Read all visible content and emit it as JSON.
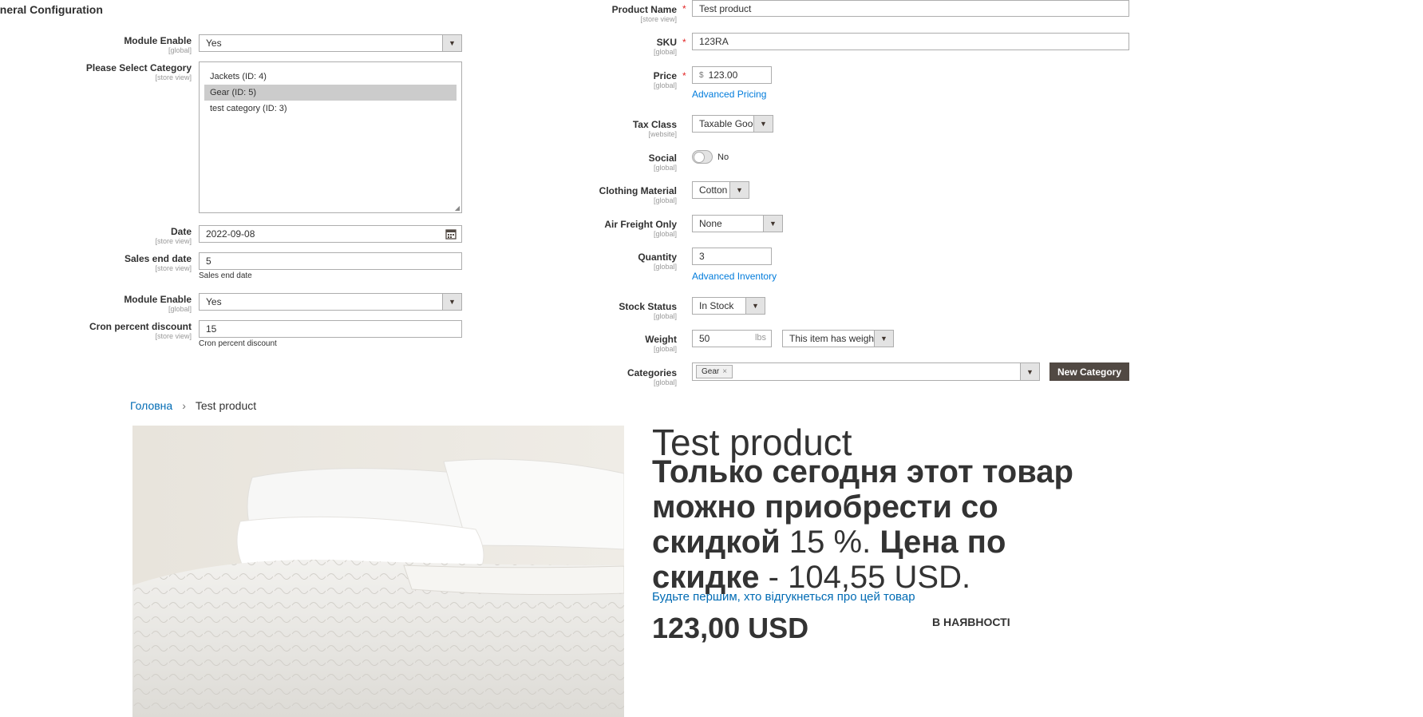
{
  "config": {
    "section_title": "eneral Configuration",
    "module_enable_1": {
      "label": "Module Enable",
      "scope": "[global]",
      "value": "Yes"
    },
    "category": {
      "label": "Please Select Category",
      "scope": "[store view]",
      "options": [
        "Jackets (ID: 4)",
        "Gear (ID: 5)",
        "test category (ID: 3)"
      ],
      "selected_index": 1
    },
    "date": {
      "label": "Date",
      "scope": "[store view]",
      "value": "2022-09-08"
    },
    "sales_end": {
      "label": "Sales end date",
      "scope": "[store view]",
      "value": "5",
      "note": "Sales end date"
    },
    "module_enable_2": {
      "label": "Module Enable",
      "scope": "[global]",
      "value": "Yes"
    },
    "cron": {
      "label": "Cron percent discount",
      "scope": "[store view]",
      "value": "15",
      "note": "Cron percent discount"
    }
  },
  "product_form": {
    "product_name": {
      "label": "Product Name",
      "scope": "[store view]",
      "value": "Test product",
      "required": "*"
    },
    "sku": {
      "label": "SKU",
      "scope": "[global]",
      "value": "123RA",
      "required": "*"
    },
    "price": {
      "label": "Price",
      "scope": "[global]",
      "currency": "$",
      "value": "123.00",
      "required": "*",
      "link": "Advanced Pricing"
    },
    "tax_class": {
      "label": "Tax Class",
      "scope": "[website]",
      "value": "Taxable Goods"
    },
    "social": {
      "label": "Social",
      "scope": "[global]",
      "value": "No"
    },
    "clothing_material": {
      "label": "Clothing Material",
      "scope": "[global]",
      "value": "Cotton"
    },
    "air_freight": {
      "label": "Air Freight Only",
      "scope": "[global]",
      "value": "None"
    },
    "quantity": {
      "label": "Quantity",
      "scope": "[global]",
      "value": "3",
      "link": "Advanced Inventory"
    },
    "stock_status": {
      "label": "Stock Status",
      "scope": "[global]",
      "value": "In Stock"
    },
    "weight": {
      "label": "Weight",
      "scope": "[global]",
      "value": "50",
      "unit": "lbs",
      "has_weight": "This item has weight"
    },
    "categories": {
      "label": "Categories",
      "scope": "[global]",
      "tag": "Gear",
      "tag_remove": "×",
      "new_button": "New Category"
    }
  },
  "storefront": {
    "breadcrumb_home": "Головна",
    "breadcrumb_sep": "›",
    "breadcrumb_current": "Test product",
    "title": "Test product",
    "promo": {
      "line1": "Только сегодня этот товар",
      "line2": "можно приобрести со",
      "line3_bold": "скидкой",
      "line3_light": "15 %.",
      "line3_bold2": "Цена по",
      "line4_bold": "скидке",
      "line4_light": "- 104,55 USD."
    },
    "review_link": "Будьте першим, хто відгукнеться про цей товар",
    "price": "123,00 USD",
    "stock": "В НАЯВНОСТІ"
  },
  "icons": {
    "calendar": "calendar-icon",
    "dropdown": "chevron-down-icon",
    "remove": "close-icon"
  },
  "colors": {
    "link": "#007bdb",
    "required": "#e22626",
    "button_dark": "#514943",
    "store_link": "#006bb4"
  }
}
